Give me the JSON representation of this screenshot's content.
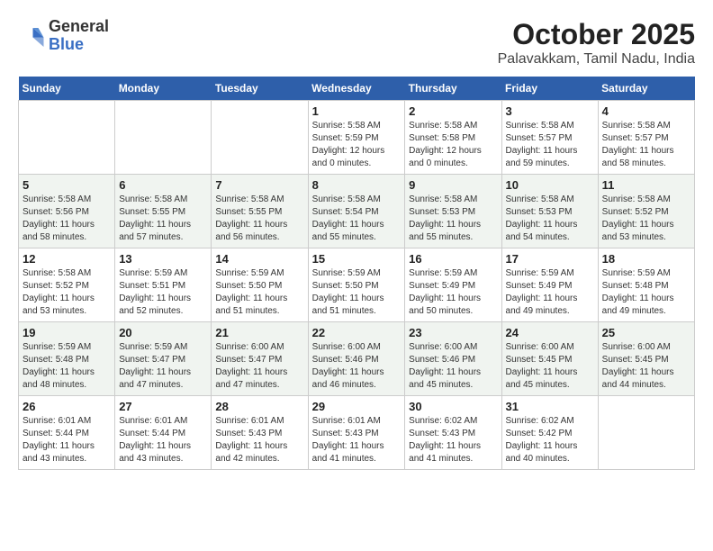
{
  "header": {
    "logo": {
      "general": "General",
      "blue": "Blue"
    },
    "title": "October 2025",
    "location": "Palavakkam, Tamil Nadu, India"
  },
  "weekdays": [
    "Sunday",
    "Monday",
    "Tuesday",
    "Wednesday",
    "Thursday",
    "Friday",
    "Saturday"
  ],
  "weeks": [
    [
      {
        "day": "",
        "info": ""
      },
      {
        "day": "",
        "info": ""
      },
      {
        "day": "",
        "info": ""
      },
      {
        "day": "1",
        "info": "Sunrise: 5:58 AM\nSunset: 5:59 PM\nDaylight: 12 hours\nand 0 minutes."
      },
      {
        "day": "2",
        "info": "Sunrise: 5:58 AM\nSunset: 5:58 PM\nDaylight: 12 hours\nand 0 minutes."
      },
      {
        "day": "3",
        "info": "Sunrise: 5:58 AM\nSunset: 5:57 PM\nDaylight: 11 hours\nand 59 minutes."
      },
      {
        "day": "4",
        "info": "Sunrise: 5:58 AM\nSunset: 5:57 PM\nDaylight: 11 hours\nand 58 minutes."
      }
    ],
    [
      {
        "day": "5",
        "info": "Sunrise: 5:58 AM\nSunset: 5:56 PM\nDaylight: 11 hours\nand 58 minutes."
      },
      {
        "day": "6",
        "info": "Sunrise: 5:58 AM\nSunset: 5:55 PM\nDaylight: 11 hours\nand 57 minutes."
      },
      {
        "day": "7",
        "info": "Sunrise: 5:58 AM\nSunset: 5:55 PM\nDaylight: 11 hours\nand 56 minutes."
      },
      {
        "day": "8",
        "info": "Sunrise: 5:58 AM\nSunset: 5:54 PM\nDaylight: 11 hours\nand 55 minutes."
      },
      {
        "day": "9",
        "info": "Sunrise: 5:58 AM\nSunset: 5:53 PM\nDaylight: 11 hours\nand 55 minutes."
      },
      {
        "day": "10",
        "info": "Sunrise: 5:58 AM\nSunset: 5:53 PM\nDaylight: 11 hours\nand 54 minutes."
      },
      {
        "day": "11",
        "info": "Sunrise: 5:58 AM\nSunset: 5:52 PM\nDaylight: 11 hours\nand 53 minutes."
      }
    ],
    [
      {
        "day": "12",
        "info": "Sunrise: 5:58 AM\nSunset: 5:52 PM\nDaylight: 11 hours\nand 53 minutes."
      },
      {
        "day": "13",
        "info": "Sunrise: 5:59 AM\nSunset: 5:51 PM\nDaylight: 11 hours\nand 52 minutes."
      },
      {
        "day": "14",
        "info": "Sunrise: 5:59 AM\nSunset: 5:50 PM\nDaylight: 11 hours\nand 51 minutes."
      },
      {
        "day": "15",
        "info": "Sunrise: 5:59 AM\nSunset: 5:50 PM\nDaylight: 11 hours\nand 51 minutes."
      },
      {
        "day": "16",
        "info": "Sunrise: 5:59 AM\nSunset: 5:49 PM\nDaylight: 11 hours\nand 50 minutes."
      },
      {
        "day": "17",
        "info": "Sunrise: 5:59 AM\nSunset: 5:49 PM\nDaylight: 11 hours\nand 49 minutes."
      },
      {
        "day": "18",
        "info": "Sunrise: 5:59 AM\nSunset: 5:48 PM\nDaylight: 11 hours\nand 49 minutes."
      }
    ],
    [
      {
        "day": "19",
        "info": "Sunrise: 5:59 AM\nSunset: 5:48 PM\nDaylight: 11 hours\nand 48 minutes."
      },
      {
        "day": "20",
        "info": "Sunrise: 5:59 AM\nSunset: 5:47 PM\nDaylight: 11 hours\nand 47 minutes."
      },
      {
        "day": "21",
        "info": "Sunrise: 6:00 AM\nSunset: 5:47 PM\nDaylight: 11 hours\nand 47 minutes."
      },
      {
        "day": "22",
        "info": "Sunrise: 6:00 AM\nSunset: 5:46 PM\nDaylight: 11 hours\nand 46 minutes."
      },
      {
        "day": "23",
        "info": "Sunrise: 6:00 AM\nSunset: 5:46 PM\nDaylight: 11 hours\nand 45 minutes."
      },
      {
        "day": "24",
        "info": "Sunrise: 6:00 AM\nSunset: 5:45 PM\nDaylight: 11 hours\nand 45 minutes."
      },
      {
        "day": "25",
        "info": "Sunrise: 6:00 AM\nSunset: 5:45 PM\nDaylight: 11 hours\nand 44 minutes."
      }
    ],
    [
      {
        "day": "26",
        "info": "Sunrise: 6:01 AM\nSunset: 5:44 PM\nDaylight: 11 hours\nand 43 minutes."
      },
      {
        "day": "27",
        "info": "Sunrise: 6:01 AM\nSunset: 5:44 PM\nDaylight: 11 hours\nand 43 minutes."
      },
      {
        "day": "28",
        "info": "Sunrise: 6:01 AM\nSunset: 5:43 PM\nDaylight: 11 hours\nand 42 minutes."
      },
      {
        "day": "29",
        "info": "Sunrise: 6:01 AM\nSunset: 5:43 PM\nDaylight: 11 hours\nand 41 minutes."
      },
      {
        "day": "30",
        "info": "Sunrise: 6:02 AM\nSunset: 5:43 PM\nDaylight: 11 hours\nand 41 minutes."
      },
      {
        "day": "31",
        "info": "Sunrise: 6:02 AM\nSunset: 5:42 PM\nDaylight: 11 hours\nand 40 minutes."
      },
      {
        "day": "",
        "info": ""
      }
    ]
  ]
}
